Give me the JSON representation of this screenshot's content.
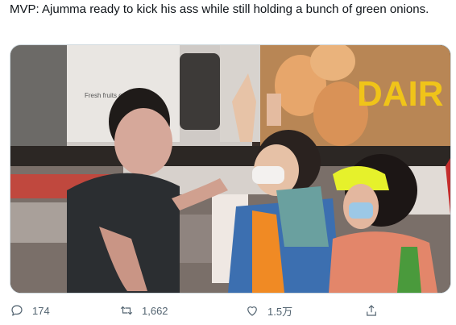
{
  "tweet": {
    "text": "MVP: Ajumma ready to kick his ass while still holding a bunch of green onions."
  },
  "media": {
    "store_sign_text": "DAIR",
    "poster_text": "Fresh fruits onto"
  },
  "actions": {
    "reply_count": "174",
    "retweet_count": "1,662",
    "like_count": "1.5万",
    "share_label": ""
  }
}
